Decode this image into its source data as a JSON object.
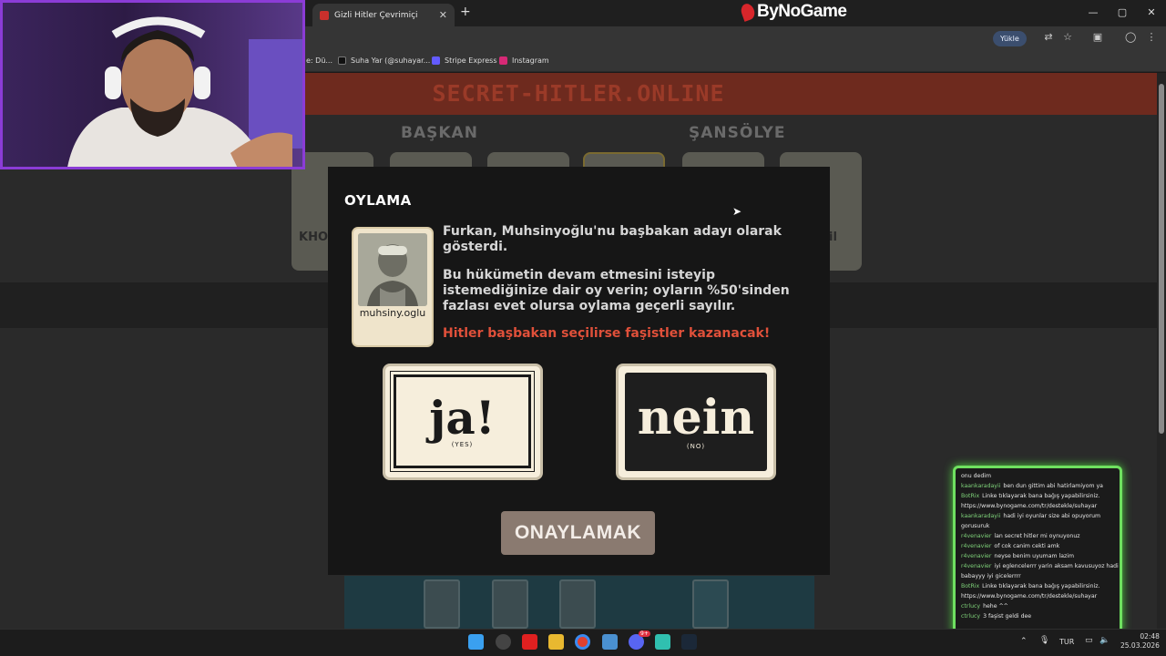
{
  "browser": {
    "tab_title": "Gizli Hitler Çevrimiçi",
    "new_tab": "+",
    "close_tab": "✕",
    "brand": "ByNoGame",
    "upload_label": "Yükle",
    "window_controls": [
      "—",
      "▢",
      "✕"
    ],
    "bookmarks": [
      {
        "label": "e: Dü...",
        "icon": "bookmark-icon",
        "color": "#555555"
      },
      {
        "label": "Suha Yar (@suhayar...",
        "icon": "tiktok-icon",
        "color": "#111111"
      },
      {
        "label": "Stripe Express",
        "icon": "stripe-icon",
        "color": "#635bff"
      },
      {
        "label": "Instagram",
        "icon": "instagram-icon",
        "color": "#d62976"
      }
    ]
  },
  "site": {
    "title": "SECRET-HITLER.ONLINE",
    "president_label": "BAŞKAN",
    "chancellor_label": "ŞANSÖLYE",
    "player_fragment_left": "KHO",
    "player_fragment_right": "il"
  },
  "vote": {
    "title": "OYLAMA",
    "nominee_name": "muhsiny.oglu",
    "message_nomination": "Furkan, Muhsinyoğlu'nu başbakan adayı olarak gösterdi.",
    "message_instruction": "Bu hükümetin devam etmesini isteyip istemediğinize dair oy verin; oyların %50'sinden fazlası evet olursa oylama geçerli sayılır.",
    "message_warning": "Hitler başbakan seçilirse faşistler kazanacak!",
    "ja_word": "ja!",
    "ja_sub": "(YES)",
    "nein_word": "nein",
    "nein_sub": "(NO)",
    "confirm_label": "ONAYLAMAK"
  },
  "chat": [
    {
      "user": "",
      "text": "onu dedim"
    },
    {
      "user": "kaankaradayii",
      "text": "ben dun gittim abi hatirlamiyom ya"
    },
    {
      "user": "BotRix",
      "text": "Linke tıklayarak bana bağış yapabilirsiniz. https://www.bynogame.com/tr/destekle/suhayar"
    },
    {
      "user": "kaankaradayii",
      "text": "hadi iyi oyunlar size abi opuyorum gorusuruk"
    },
    {
      "user": "r4venavier",
      "text": "lan secret hitler mi oynuyonuz"
    },
    {
      "user": "r4venavier",
      "text": "of cok canim cekti amk"
    },
    {
      "user": "r4venavier",
      "text": "neyse benim uyumam lazim"
    },
    {
      "user": "r4venavier",
      "text": "iyi eglencelerrr yarin aksam kavusuyoz hadi babayyy iyi gicelerrrr"
    },
    {
      "user": "BotRix",
      "text": "Linke tıklayarak bana bağış yapabilirsiniz. https://www.bynogame.com/tr/destekle/suhayar"
    },
    {
      "user": "ctrlucy",
      "text": "hehe ^^"
    },
    {
      "user": "ctrlucy",
      "text": "3 faşist geldi dee"
    }
  ],
  "taskbar": {
    "language": "TUR",
    "time": "02:48",
    "date": "25.03.2026",
    "discord_badge": "9+"
  },
  "colors": {
    "accent_red": "#e0503a",
    "chat_border": "#6fe060",
    "webcam_border": "#8b3cd6",
    "confirm_button": "#8a7a70"
  }
}
